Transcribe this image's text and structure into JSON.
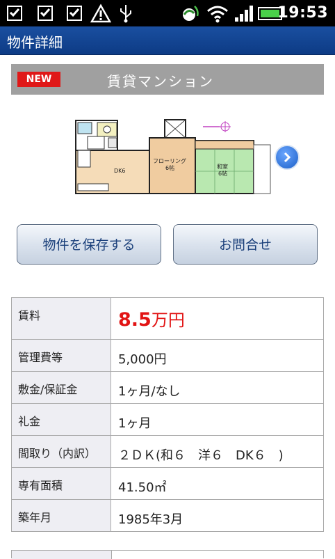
{
  "status_bar": {
    "time": "19:53",
    "icons": [
      "notification-check-icon",
      "notification-check-icon",
      "notification-check-icon",
      "warning-icon",
      "usb-icon",
      "sync-icon",
      "wifi-icon",
      "signal-icon",
      "battery-icon"
    ]
  },
  "titlebar": {
    "title": "物件詳細"
  },
  "header": {
    "badge": "NEW",
    "title": "賃貸マンション"
  },
  "floorplan": {
    "rooms": [
      {
        "label": "DK6"
      },
      {
        "label": "フローリング\n6帖"
      },
      {
        "label": "和室\n6帖"
      }
    ]
  },
  "buttons": {
    "save": "物件を保存する",
    "inquiry": "お問合せ"
  },
  "details": {
    "rent_label": "賃料",
    "rent_value": "8.5",
    "rent_unit": "万円",
    "rows": [
      {
        "label": "管理費等",
        "value": "5,000円"
      },
      {
        "label": "敷金/保証金",
        "value": "1ヶ月/なし"
      },
      {
        "label": "礼金",
        "value": "1ヶ月"
      },
      {
        "label": "間取り（内訳）",
        "value": "２ＤＫ(和６　洋６　DK６　)"
      },
      {
        "label": "専有面積",
        "value": "41.50㎡"
      },
      {
        "label": "築年月",
        "value": "1985年3月"
      }
    ]
  },
  "colors": {
    "accent": "#e21414",
    "titlebar": "#1a4fa0",
    "button_text": "#1a3f7a"
  }
}
